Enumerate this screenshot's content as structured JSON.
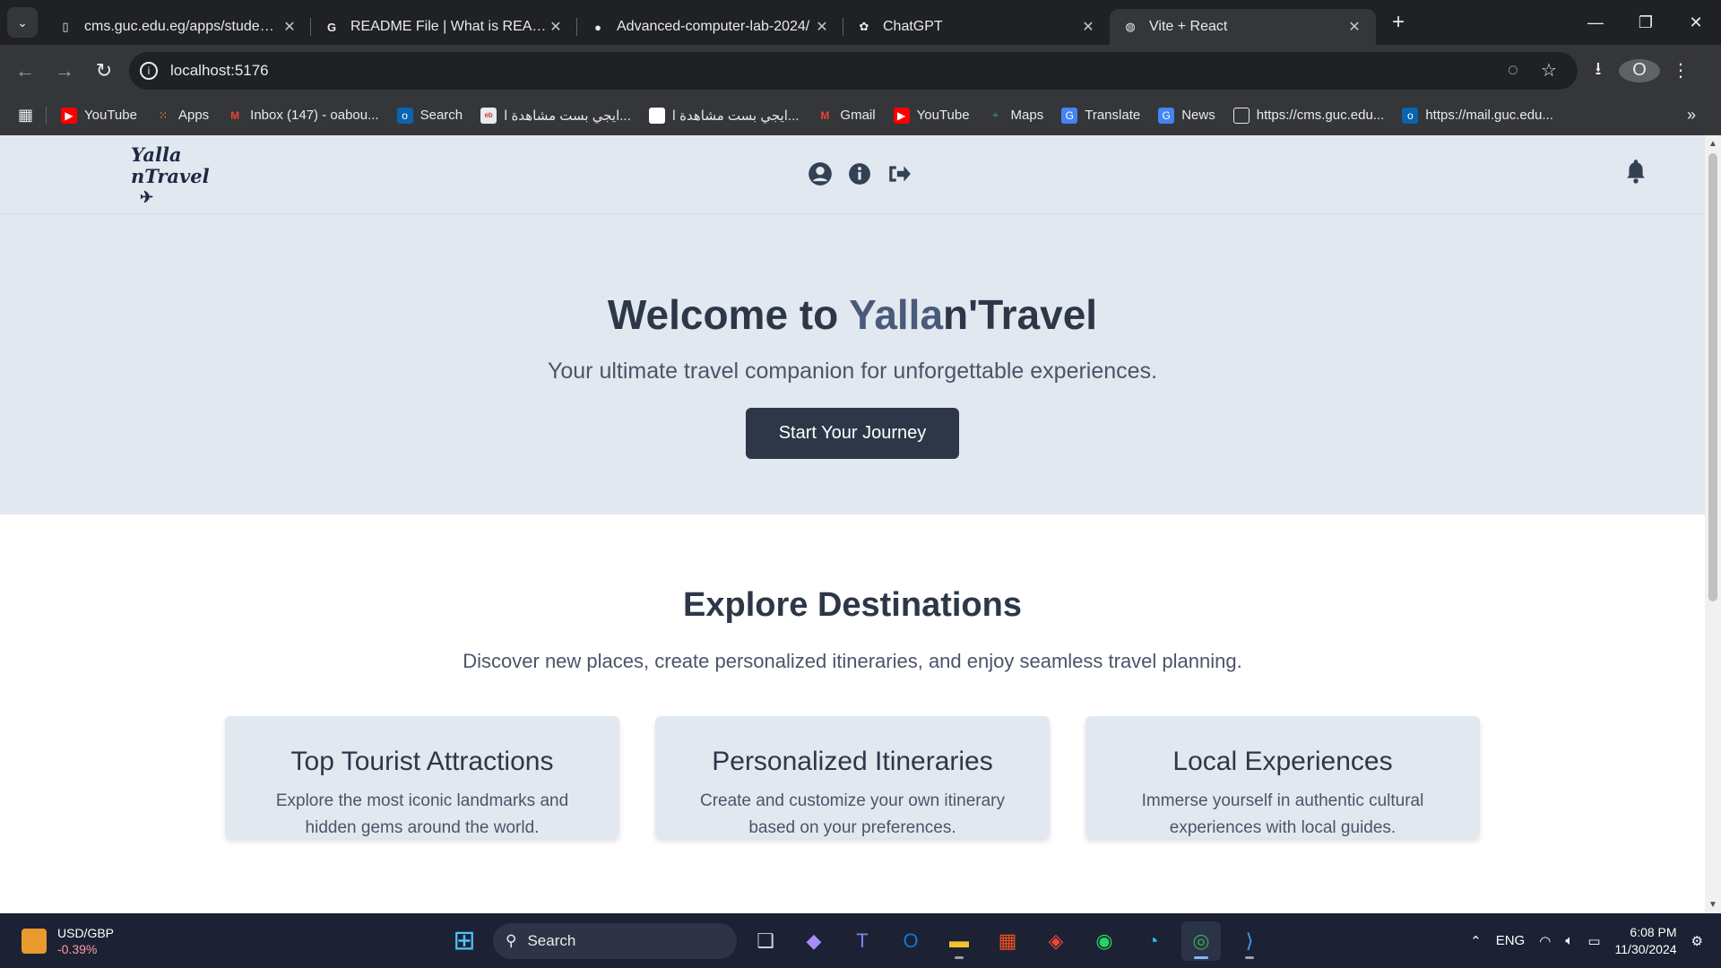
{
  "browser": {
    "tabs": [
      {
        "title": "cms.guc.edu.eg/apps/student/C",
        "icon": "document-icon",
        "active": false
      },
      {
        "title": "README File | What is README",
        "icon": "google-icon",
        "active": false
      },
      {
        "title": "Advanced-computer-lab-2024/",
        "icon": "github-icon",
        "active": false
      },
      {
        "title": "ChatGPT",
        "icon": "chatgpt-icon",
        "active": false
      },
      {
        "title": "Vite + React",
        "icon": "globe-icon",
        "active": true
      }
    ],
    "url": "localhost:5176",
    "profile_initial": "O",
    "bookmarks": [
      {
        "label": "YouTube",
        "icon": "youtube-icon",
        "color": "#ff0000"
      },
      {
        "label": "Apps",
        "icon": "apps-grid-icon",
        "color": "#fbbc04"
      },
      {
        "label": "Inbox (147) - oabou...",
        "icon": "gmail-icon",
        "color": "#ea4335"
      },
      {
        "label": "Search",
        "icon": "outlook-icon",
        "color": "#0a64ad"
      },
      {
        "label": "ايجي بست مشاهدة ا...",
        "icon": "egybest-icon",
        "color": "#e8eaed"
      },
      {
        "label": "ايجي بست مشاهدة ا...",
        "icon": "blank-page-icon",
        "color": "#ffffff"
      },
      {
        "label": "Gmail",
        "icon": "gmail-icon",
        "color": "#ea4335"
      },
      {
        "label": "YouTube",
        "icon": "youtube-icon",
        "color": "#ff0000"
      },
      {
        "label": "Maps",
        "icon": "maps-icon",
        "color": "#34a853"
      },
      {
        "label": "Translate",
        "icon": "translate-icon",
        "color": "#4285f4"
      },
      {
        "label": "News",
        "icon": "news-icon",
        "color": "#4285f4"
      },
      {
        "label": "https://cms.guc.edu...",
        "icon": "document-icon",
        "color": "#e8eaed"
      },
      {
        "label": "https://mail.guc.edu...",
        "icon": "outlook-icon",
        "color": "#0a64ad"
      }
    ]
  },
  "site": {
    "logo_line1": "Yalla",
    "logo_line2": "nTravel",
    "hero": {
      "title_prefix": "Welcome to ",
      "title_accent": "Yalla",
      "title_suffix": "n'Travel",
      "subtitle": "Your ultimate travel companion for unforgettable experiences.",
      "cta": "Start Your Journey"
    },
    "explore": {
      "title": "Explore Destinations",
      "subtitle": "Discover new places, create personalized itineraries, and enjoy seamless travel planning.",
      "cards": [
        {
          "title": "Top Tourist Attractions",
          "text": "Explore the most iconic landmarks and hidden gems around the world."
        },
        {
          "title": "Personalized Itineraries",
          "text": "Create and customize your own itinerary based on your preferences."
        },
        {
          "title": "Local Experiences",
          "text": "Immerse yourself in authentic cultural experiences with local guides."
        }
      ]
    }
  },
  "taskbar": {
    "widget_title": "USD/GBP",
    "widget_value": "-0.39%",
    "search_label": "Search",
    "lang": "ENG",
    "time": "6:08 PM",
    "date": "11/30/2024",
    "chrome_badge": "0"
  },
  "colors": {
    "hero_bg": "#e2e8f0",
    "brand_dark": "#2d3748",
    "accent": "#4a5a7a"
  }
}
